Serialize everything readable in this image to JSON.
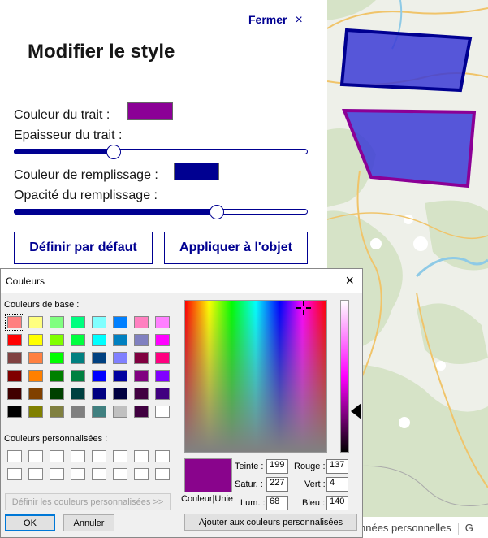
{
  "panel": {
    "close_label": "Fermer",
    "close_glyph": "×",
    "title": "Modifier le style",
    "stroke_color_label": "Couleur du trait :",
    "stroke_color": "#8b0096",
    "stroke_width_label": "Epaisseur du trait :",
    "stroke_width_value": 0.34,
    "fill_color_label": "Couleur de remplissage :",
    "fill_color": "#000091",
    "fill_opacity_label": "Opacité du remplissage :",
    "fill_opacity_value": 0.69,
    "default_button": "Définir par défaut",
    "apply_button": "Appliquer à l'objet"
  },
  "map": {
    "attribution": "nnées personnelles",
    "attribution_trailing": "G"
  },
  "dialog": {
    "title": "Couleurs",
    "close_glyph": "×",
    "basic_colors_label": "Couleurs de base :",
    "custom_colors_label": "Couleurs personnalisées :",
    "define_custom_button": "Définir les couleurs personnalisées >>",
    "ok_button": "OK",
    "cancel_button": "Annuler",
    "add_custom_button": "Ajouter aux couleurs personnalisées",
    "preview_label": "Couleur|Unie",
    "preview_color": "#89048c",
    "hue_label": "Teinte :",
    "hue": "199",
    "sat_label": "Satur. :",
    "sat": "227",
    "lum_label": "Lum. :",
    "lum": "68",
    "red_label": "Rouge :",
    "red": "137",
    "green_label": "Vert :",
    "green": "4",
    "blue_label": "Bleu :",
    "blue": "140",
    "basic_colors": [
      "#ff8080",
      "#ffff80",
      "#80ff80",
      "#00ff80",
      "#80ffff",
      "#0080ff",
      "#ff80c0",
      "#ff80ff",
      "#ff0000",
      "#ffff00",
      "#80ff00",
      "#00ff40",
      "#00ffff",
      "#0080c0",
      "#8080c0",
      "#ff00ff",
      "#804040",
      "#ff8040",
      "#00ff00",
      "#008080",
      "#004080",
      "#8080ff",
      "#800040",
      "#ff0080",
      "#800000",
      "#ff8000",
      "#008000",
      "#008040",
      "#0000ff",
      "#0000a0",
      "#800080",
      "#8000ff",
      "#400000",
      "#804000",
      "#004000",
      "#004040",
      "#000080",
      "#000040",
      "#400040",
      "#400080",
      "#000000",
      "#808000",
      "#808040",
      "#808080",
      "#408080",
      "#c0c0c0",
      "#400040",
      "#ffffff"
    ],
    "custom_colors": [
      "#ffffff",
      "#ffffff",
      "#ffffff",
      "#ffffff",
      "#ffffff",
      "#ffffff",
      "#ffffff",
      "#ffffff",
      "#ffffff",
      "#ffffff",
      "#ffffff",
      "#ffffff",
      "#ffffff",
      "#ffffff",
      "#ffffff",
      "#ffffff"
    ]
  }
}
